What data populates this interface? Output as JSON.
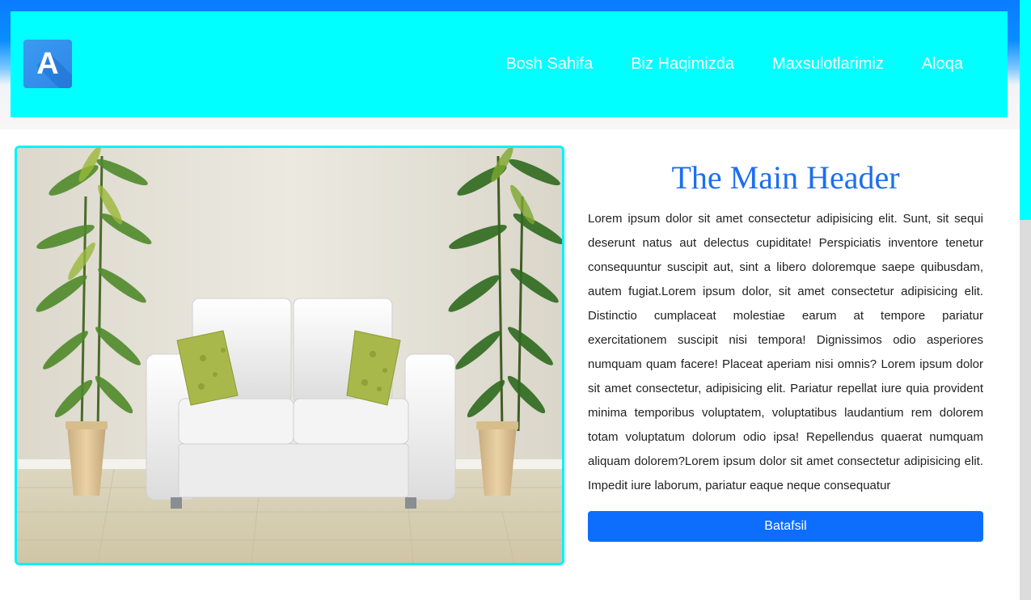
{
  "header": {
    "logo_letter": "A",
    "nav": [
      {
        "label": "Bosh Sahifa"
      },
      {
        "label": "Biz Haqimizda"
      },
      {
        "label": "Maxsulotlarimiz"
      },
      {
        "label": "Aloqa"
      }
    ]
  },
  "main": {
    "title": "The Main Header",
    "body": "Lorem ipsum dolor sit amet consectetur adipisicing elit. Sunt, sit sequi deserunt natus aut delectus cupiditate! Perspiciatis inventore tenetur consequuntur suscipit aut, sint a libero doloremque saepe quibusdam, autem fugiat.Lorem ipsum dolor, sit amet consectetur adipisicing elit. Distinctio cumplaceat molestiae earum at tempore pariatur exercitationem suscipit nisi tempora! Dignissimos odio asperiores numquam quam facere! Placeat aperiam nisi omnis? Lorem ipsum dolor sit amet consectetur, adipisicing elit. Pariatur repellat iure quia provident minima temporibus voluptatem, voluptatibus laudantium rem dolorem totam voluptatum dolorum odio ipsa! Repellendus quaerat numquam aliquam dolorem?Lorem ipsum dolor sit amet consectetur adipisicing elit. Impedit iure laborum, pariatur eaque neque consequatur",
    "button_label": "Batafsil"
  },
  "colors": {
    "navbar_bg": "#00ffff",
    "top_band": "#0a7bff",
    "header_text": "#1e6ef0",
    "button_bg": "#0d6efd",
    "image_border": "#00f2ff"
  },
  "icons": {
    "logo": "letter-a-logo-icon",
    "hero_image": "white-sofa-with-plants-photo"
  }
}
